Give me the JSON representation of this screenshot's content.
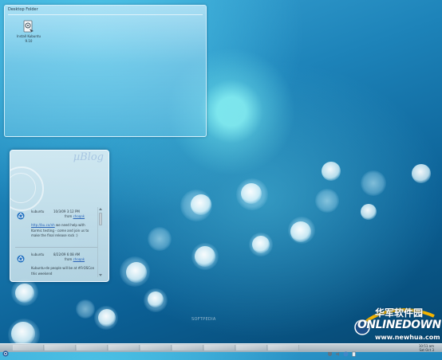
{
  "folder": {
    "title": "Desktop Folder",
    "icon_name": "installer-icon",
    "icon_label_line1": "Install Kubuntu",
    "icon_label_line2": "9.10"
  },
  "blog": {
    "title": "µBlog",
    "posts": [
      {
        "user": "kubuntu",
        "time": "10/3/09 3:12 PM",
        "from_prefix": "from",
        "from_link": "choqok",
        "link": "http://bu.co/nh",
        "body": "we need help with Karmic testing - come and join us to make the final release rock :)"
      },
      {
        "user": "kubuntu",
        "time": "8/22/09 6:08 AM",
        "from_prefix": "from",
        "from_link": "choqok",
        "body": "Kubuntu-de people will be at #FrOSCon this weekend"
      }
    ]
  },
  "watermark": {
    "center": "SOFTPEDIA",
    "cn": "华军软件园",
    "en": "ONLINEDOWN",
    "url": "www.newhua.com"
  },
  "panel": {
    "clock_line1": "10:51 am",
    "clock_line2": "Sat Oct 3",
    "menu_icon": "kmenu-icon"
  },
  "colors": {
    "desktop": "#1d83b9",
    "link": "#2a64b8",
    "panel": "#b4c1c9"
  }
}
